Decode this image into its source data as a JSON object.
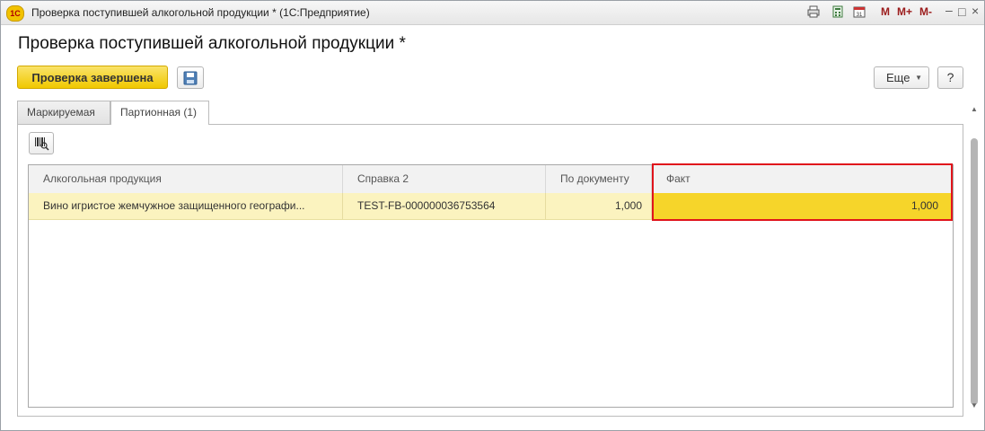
{
  "window": {
    "title": "Проверка поступившей алкогольной продукции * (1С:Предприятие)",
    "logo": "1С",
    "toolbar": {
      "m": "M",
      "m_plus": "M+",
      "m_minus": "M-",
      "calendar_day": "31"
    }
  },
  "page_title": "Проверка поступившей алкогольной продукции *",
  "toolbar": {
    "primary_label": "Проверка завершена",
    "more_label": "Еще",
    "help_label": "?"
  },
  "tabs": [
    {
      "label": "Маркируемая",
      "active": false
    },
    {
      "label": "Партионная (1)",
      "active": true
    }
  ],
  "table": {
    "columns": [
      "Алкогольная продукция",
      "Справка 2",
      "По документу",
      "Факт"
    ],
    "rows": [
      {
        "product": "Вино игристое жемчужное защищенного географи...",
        "certificate": "TEST-FB-000000036753564",
        "by_document": "1,000",
        "fact": "1,000"
      }
    ]
  },
  "colors": {
    "primary_button": "#f0c800",
    "selected_row": "#fbf3bf",
    "fact_cell": "#f6d52a",
    "highlight_border": "#e0141c"
  },
  "icons": [
    "save-icon",
    "barcode-icon",
    "calculator-icon",
    "calendar-icon",
    "print-icon",
    "minimize-icon",
    "maximize-icon",
    "close-icon"
  ]
}
